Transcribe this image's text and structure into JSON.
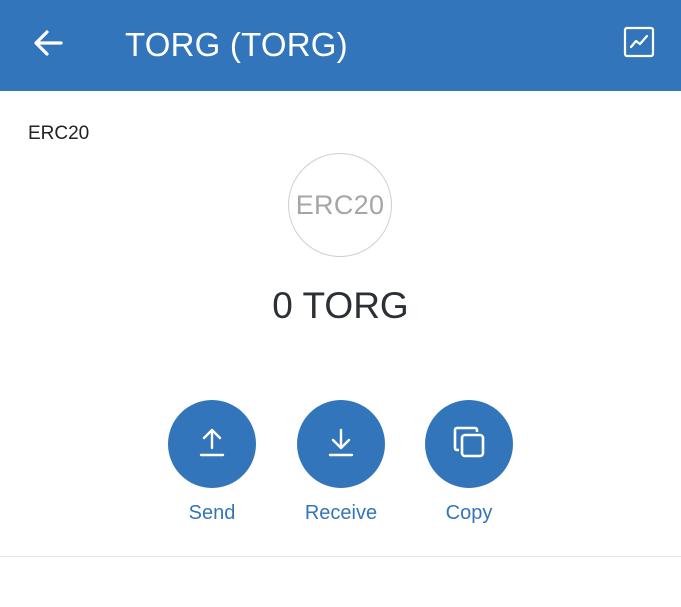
{
  "header": {
    "title": "TORG (TORG)",
    "back_icon": "arrow-left-icon",
    "chart_icon": "line-chart-icon",
    "background_color": "#3375bb"
  },
  "token": {
    "standard_label": "ERC20",
    "logo_text": "ERC20",
    "balance": "0 TORG"
  },
  "actions": [
    {
      "label": "Send",
      "icon": "upload-arrow-icon"
    },
    {
      "label": "Receive",
      "icon": "download-arrow-icon"
    },
    {
      "label": "Copy",
      "icon": "copy-icon"
    }
  ],
  "colors": {
    "accent": "#3375bb",
    "text_primary": "#2b2f36",
    "logo_text": "#a6a6a6"
  }
}
